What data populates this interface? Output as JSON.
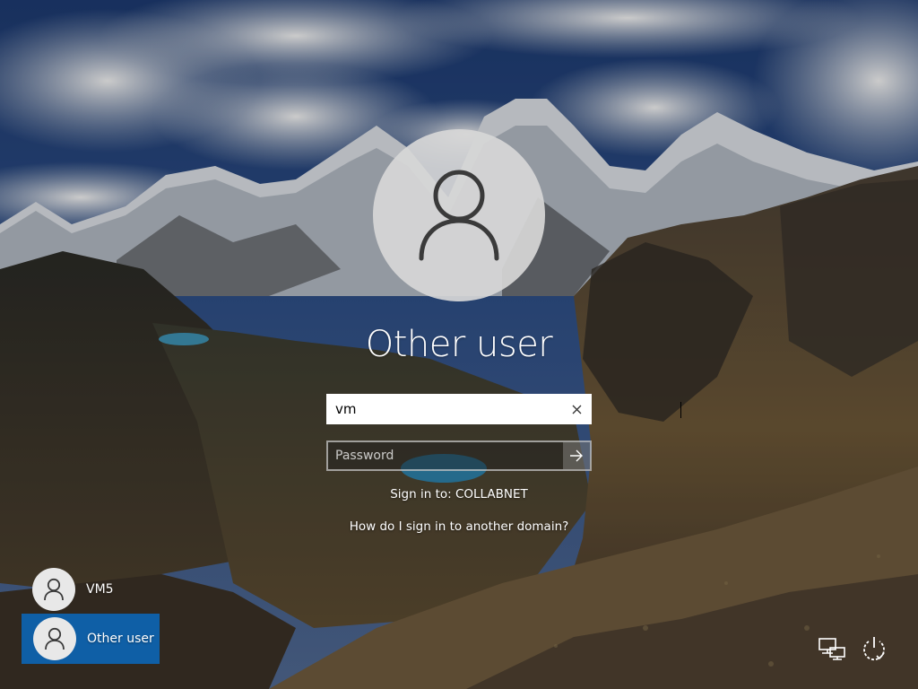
{
  "login": {
    "account_name": "Other user",
    "username_value": "vm",
    "password_placeholder": "Password",
    "sign_in_to": "Sign in to: COLLABNET",
    "other_domain_link": "How do I sign in to another domain?"
  },
  "user_tiles": [
    {
      "label": "VM5",
      "selected": false
    },
    {
      "label": "Other user",
      "selected": true
    }
  ],
  "icons": {
    "avatar": "user-icon",
    "clear": "close-icon",
    "submit": "arrow-right-icon",
    "network": "network-icon",
    "power": "power-icon"
  },
  "colors": {
    "selected_tile": "#0f5fa6",
    "avatar_bg": "#d7d7d7",
    "text": "#ffffff"
  }
}
